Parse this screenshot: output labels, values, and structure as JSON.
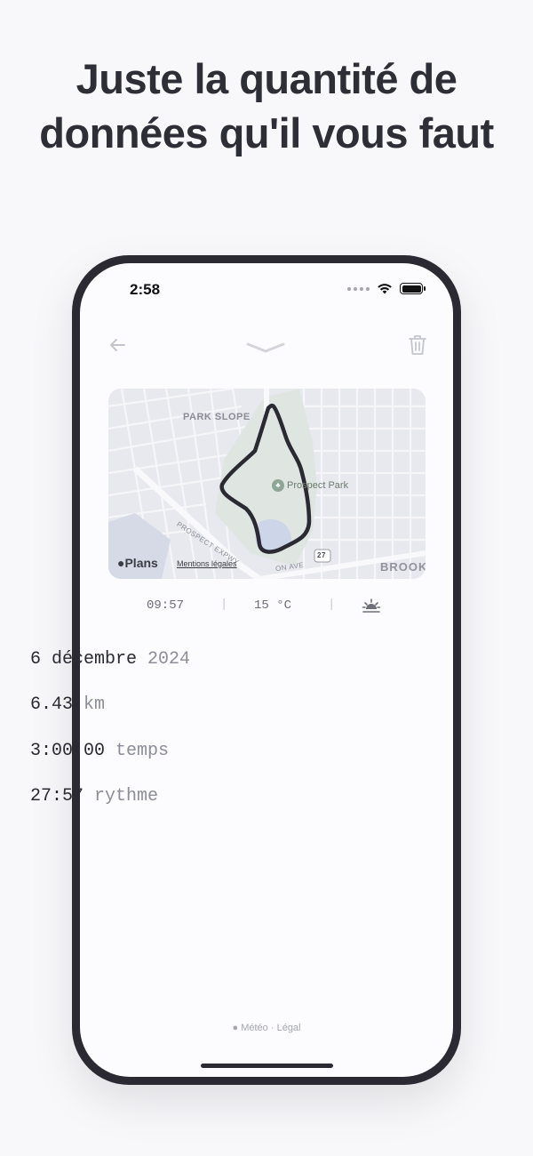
{
  "headline": "Juste la quantité de données qu'il vous faut",
  "status_bar": {
    "time": "2:58"
  },
  "map": {
    "neighborhood_label": "PARK SLOPE",
    "park_label": "Prospect Park",
    "road_label": "PROSPECT EXPWY",
    "road_label_2": "ON AVE",
    "route_shield": "27",
    "area_label": "BROOK",
    "maps_logo": "Plans",
    "legal_link": "Mentions légales"
  },
  "meta": {
    "time": "09:57",
    "temperature": "15 °C",
    "separator": "|",
    "weather_icon": "sunrise-icon"
  },
  "stats": {
    "date": {
      "value": "6 décembre",
      "muted": "2024"
    },
    "distance": {
      "value": "6.43",
      "muted": "km"
    },
    "duration": {
      "value": "3:00:00",
      "muted": "temps"
    },
    "pace": {
      "value": "27:57",
      "muted": "rythme"
    }
  },
  "footer": {
    "weather_provider": "Météo",
    "dot": "·",
    "legal": "Légal"
  },
  "colors": {
    "background": "#f8f8fb",
    "phone_frame": "#2b2a33",
    "route": "#2b2a33",
    "muted_text": "#8c8d98"
  }
}
